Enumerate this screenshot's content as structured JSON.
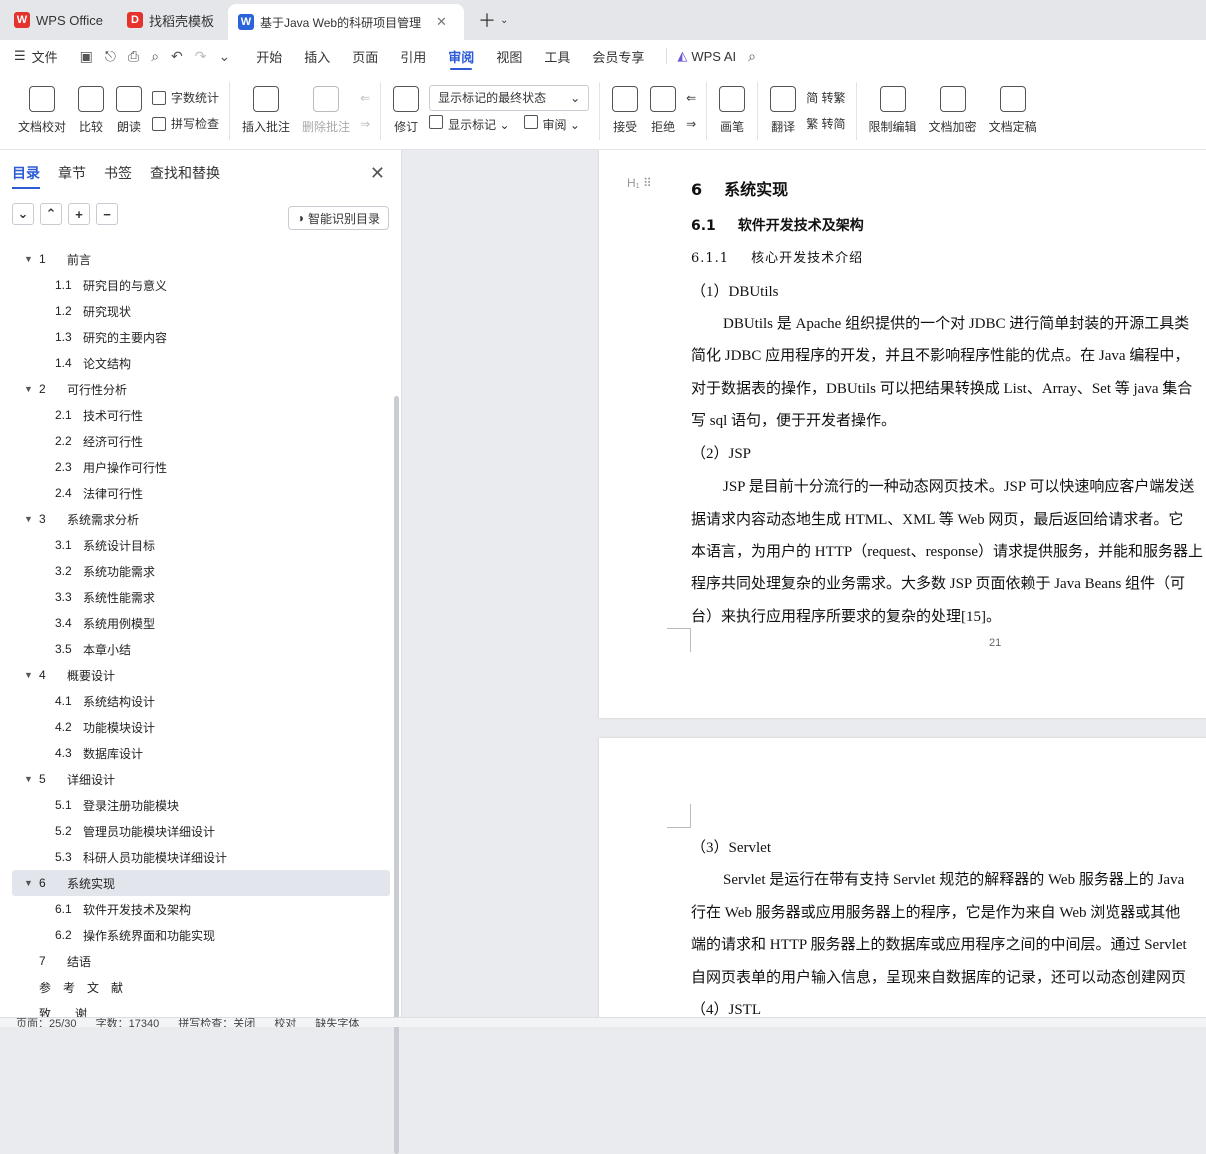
{
  "tabs": [
    {
      "label": "WPS Office",
      "logo": "W",
      "logo_color": "#e5322d"
    },
    {
      "label": "找稻壳模板",
      "logo": "D",
      "logo_color": "#e5322d"
    },
    {
      "label": "基于Java Web的科研项目管理",
      "logo": "W",
      "logo_color": "#2b63d8",
      "active": true
    }
  ],
  "menubar": {
    "file": "文件",
    "items": [
      "开始",
      "插入",
      "页面",
      "引用",
      "审阅",
      "视图",
      "工具",
      "会员专享"
    ],
    "active": "审阅",
    "ai": "WPS AI"
  },
  "ribbon": {
    "doc_check": "文档校对",
    "compare": "比较",
    "read_aloud": "朗读",
    "word_count": "字数统计",
    "spell_check": "拼写检查",
    "insert_comment": "插入批注",
    "delete_comment": "删除批注",
    "revise": "修订",
    "show_markup_select": "显示标记的最终状态",
    "show_markup": "显示标记",
    "review": "审阅",
    "accept": "接受",
    "reject": "拒绝",
    "pen": "画笔",
    "translate": "翻译",
    "to_traditional": "简 转繁",
    "to_simplified": "繁 转简",
    "restrict_edit": "限制编辑",
    "encrypt": "文档加密",
    "finalize": "文档定稿"
  },
  "sidebar": {
    "tabs": [
      "目录",
      "章节",
      "书签",
      "查找和替换"
    ],
    "active_tab": "目录",
    "smart_toc": "智能识别目录",
    "toc": [
      {
        "level": 1,
        "num": "1",
        "text": "前言",
        "expanded": true
      },
      {
        "level": 2,
        "num": "1.1",
        "text": "研究目的与意义"
      },
      {
        "level": 2,
        "num": "1.2",
        "text": "研究现状"
      },
      {
        "level": 2,
        "num": "1.3",
        "text": "研究的主要内容"
      },
      {
        "level": 2,
        "num": "1.4",
        "text": "论文结构"
      },
      {
        "level": 1,
        "num": "2",
        "text": "可行性分析",
        "expanded": true
      },
      {
        "level": 2,
        "num": "2.1",
        "text": "技术可行性"
      },
      {
        "level": 2,
        "num": "2.2",
        "text": "经济可行性"
      },
      {
        "level": 2,
        "num": "2.3",
        "text": "用户操作可行性"
      },
      {
        "level": 2,
        "num": "2.4",
        "text": "法律可行性"
      },
      {
        "level": 1,
        "num": "3",
        "text": "系统需求分析",
        "expanded": true
      },
      {
        "level": 2,
        "num": "3.1",
        "text": "系统设计目标"
      },
      {
        "level": 2,
        "num": "3.2",
        "text": "系统功能需求"
      },
      {
        "level": 2,
        "num": "3.3",
        "text": "系统性能需求"
      },
      {
        "level": 2,
        "num": "3.4",
        "text": "系统用例模型"
      },
      {
        "level": 2,
        "num": "3.5",
        "text": "本章小结"
      },
      {
        "level": 1,
        "num": "4",
        "text": "概要设计",
        "expanded": true
      },
      {
        "level": 2,
        "num": "4.1",
        "text": "系统结构设计"
      },
      {
        "level": 2,
        "num": "4.2",
        "text": "功能模块设计"
      },
      {
        "level": 2,
        "num": "4.3",
        "text": "数据库设计"
      },
      {
        "level": 1,
        "num": "5",
        "text": "详细设计",
        "expanded": true
      },
      {
        "level": 2,
        "num": "5.1",
        "text": "登录注册功能模块"
      },
      {
        "level": 2,
        "num": "5.2",
        "text": "管理员功能模块详细设计"
      },
      {
        "level": 2,
        "num": "5.3",
        "text": "科研人员功能模块详细设计"
      },
      {
        "level": 1,
        "num": "6",
        "text": "系统实现",
        "expanded": true,
        "selected": true
      },
      {
        "level": 2,
        "num": "6.1",
        "text": "软件开发技术及架构"
      },
      {
        "level": 2,
        "num": "6.2",
        "text": "操作系统界面和功能实现"
      },
      {
        "level": 1,
        "num": "7",
        "text": "结语",
        "expanded": null
      },
      {
        "level": 1,
        "num": "",
        "text": "参　考　文　献",
        "expanded": null
      },
      {
        "level": 1,
        "num": "",
        "text": "致　　谢",
        "expanded": null
      }
    ]
  },
  "document": {
    "page1": {
      "h1_num": "6",
      "h1_text": "系统实现",
      "h2_num": "6.1",
      "h2_text": "软件开发技术及架构",
      "h3_num": "6.1.1",
      "h3_text": "核心开发技术介绍",
      "sub1": "（1）DBUtils",
      "p1": [
        "DBUtils 是 Apache 组织提供的一个对 JDBC 进行简单封装的开源工具类",
        "简化 JDBC 应用程序的开发，并且不影响程序性能的优点。在 Java 编程中，",
        "对于数据表的操作，DBUtils 可以把结果转换成 List、Array、Set 等 java 集合",
        "写 sql 语句，便于开发者操作。"
      ],
      "sub2": "（2）JSP",
      "p2": [
        "JSP 是目前十分流行的一种动态网页技术。JSP 可以快速响应客户端发送",
        "据请求内容动态地生成 HTML、XML 等 Web 网页，最后返回给请求者。它",
        "本语言，为用户的 HTTP（request、response）请求提供服务，并能和服务器上",
        "程序共同处理复杂的业务需求。大多数 JSP 页面依赖于 Java Beans 组件（可",
        "台）来执行应用程序所要求的复杂的处理[15]。"
      ],
      "page_number": "21"
    },
    "page2": {
      "sub3": "（3）Servlet",
      "p3": [
        "Servlet 是运行在带有支持 Servlet 规范的解释器的 Web 服务器上的 Java",
        "行在 Web 服务器或应用服务器上的程序，它是作为来自 Web 浏览器或其他",
        "端的请求和 HTTP 服务器上的数据库或应用程序之间的中间层。通过 Servlet",
        "自网页表单的用户输入信息，呈现来自数据库的记录，还可以动态创建网页"
      ],
      "sub4": "（4）JSTL"
    }
  },
  "status": {
    "page": "页面：25/30",
    "words": "字数：17340",
    "spell": "拼写检查：关闭",
    "proof": "校对",
    "font_missing": "缺失字体"
  }
}
